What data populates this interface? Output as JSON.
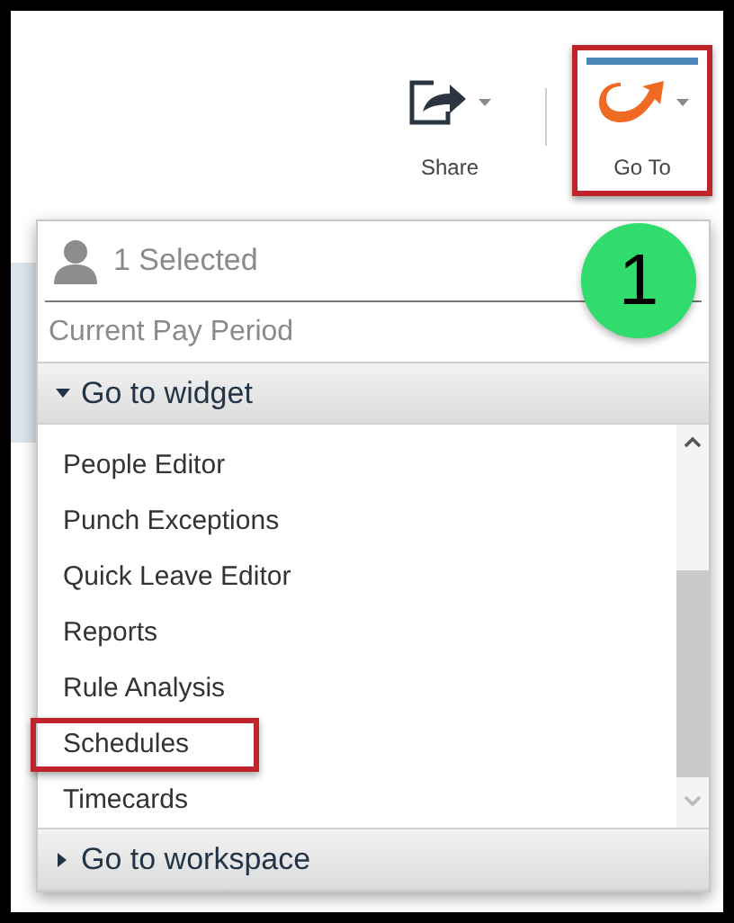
{
  "toolbar": {
    "buttons": [
      {
        "kind": "share",
        "label": "Share",
        "highlighted": false
      },
      {
        "kind": "goto",
        "label": "Go To",
        "highlighted": true
      }
    ]
  },
  "callout": "1",
  "panel": {
    "selection": "1 Selected",
    "period": "Current Pay Period",
    "sections": [
      {
        "label": "Go to widget",
        "expanded": true,
        "items": [
          {
            "label": "People Editor",
            "highlighted": false
          },
          {
            "label": "Punch Exceptions",
            "highlighted": false
          },
          {
            "label": "Quick Leave Editor",
            "highlighted": false
          },
          {
            "label": "Reports",
            "highlighted": false
          },
          {
            "label": "Rule Analysis",
            "highlighted": false
          },
          {
            "label": "Schedules",
            "highlighted": true
          },
          {
            "label": "Timecards",
            "highlighted": false
          }
        ]
      },
      {
        "label": "Go to workspace",
        "expanded": false
      }
    ]
  }
}
